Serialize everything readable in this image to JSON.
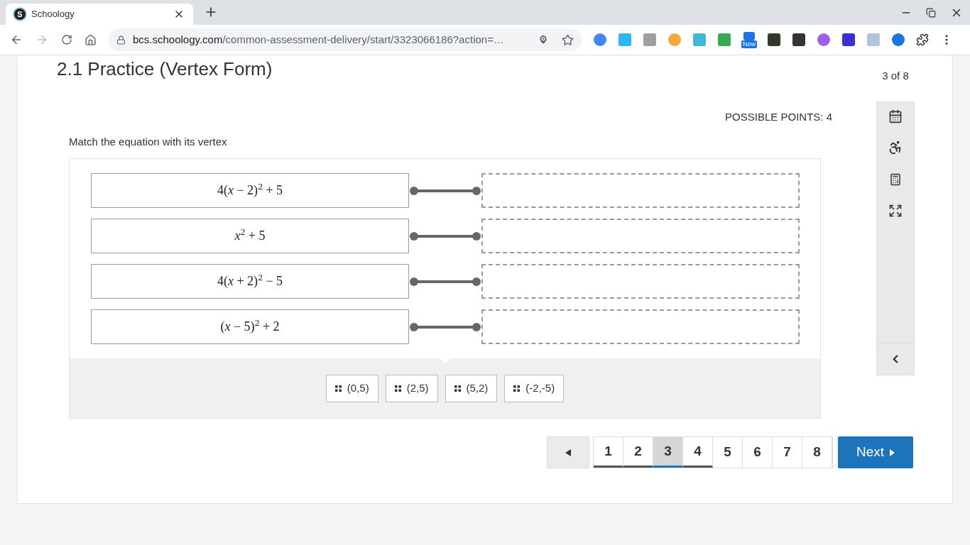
{
  "browser": {
    "tab": {
      "favicon": "S",
      "title": "Schoology"
    },
    "url_host": "bcs.schoology.com",
    "url_path": "/common-assessment-delivery/start/3323066186?action=…",
    "extension_badge": "New"
  },
  "assessment": {
    "title": "2.1 Practice (Vertex Form)",
    "position": "3 of 8",
    "possible_points": "POSSIBLE POINTS: 4",
    "prompt": "Match the equation with its vertex",
    "equations": [
      {
        "text": "4(*x* − 2)$^{2}$ + 5"
      },
      {
        "text": "*x*$^{2}$ + 5"
      },
      {
        "text": "4(*x* + 2)$^{2}$ − 5"
      },
      {
        "text": "(*x* − 5)$^{2}$ + 2"
      }
    ],
    "answers": [
      {
        "label": "(0,5)"
      },
      {
        "label": "(2,5)"
      },
      {
        "label": "(5,2)"
      },
      {
        "label": "(-2,-5)"
      }
    ]
  },
  "pagination": {
    "pages": [
      {
        "label": "1",
        "selected": false,
        "visited": true
      },
      {
        "label": "2",
        "selected": false,
        "visited": true
      },
      {
        "label": "3",
        "selected": true,
        "visited": true
      },
      {
        "label": "4",
        "selected": false,
        "visited": true
      },
      {
        "label": "5",
        "selected": false,
        "visited": false
      },
      {
        "label": "6",
        "selected": false,
        "visited": false
      },
      {
        "label": "7",
        "selected": false,
        "visited": false
      },
      {
        "label": "8",
        "selected": false,
        "visited": false
      }
    ],
    "next": "Next"
  }
}
